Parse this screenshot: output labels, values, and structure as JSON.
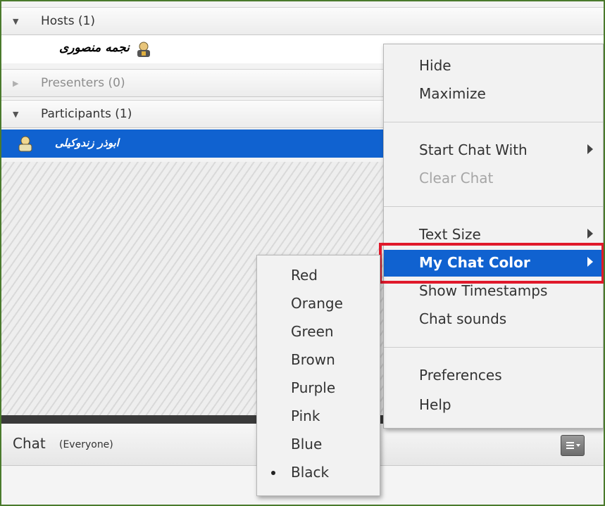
{
  "attendees": {
    "hosts_header": "Hosts (1)",
    "host_name": "نجمه منصوری",
    "presenters_header": "Presenters (0)",
    "participants_header": "Participants (1)",
    "participant_name": "ابوذر زندوکیلی"
  },
  "chat": {
    "title": "Chat",
    "scope": "(Everyone)",
    "options_icon": "menu-list-icon"
  },
  "context_menu": {
    "hide": "Hide",
    "maximize": "Maximize",
    "start_chat_with": "Start Chat With",
    "clear_chat": "Clear Chat",
    "text_size": "Text Size",
    "my_chat_color": "My Chat Color",
    "show_timestamps": "Show Timestamps",
    "chat_sounds": "Chat sounds",
    "preferences": "Preferences",
    "help": "Help"
  },
  "color_menu": {
    "items": [
      "Red",
      "Orange",
      "Green",
      "Brown",
      "Purple",
      "Pink",
      "Blue",
      "Black"
    ],
    "selected": "Black"
  },
  "colors": {
    "highlight": "#1062d0",
    "callout": "#e0192b",
    "frame": "#4a7a2c"
  }
}
